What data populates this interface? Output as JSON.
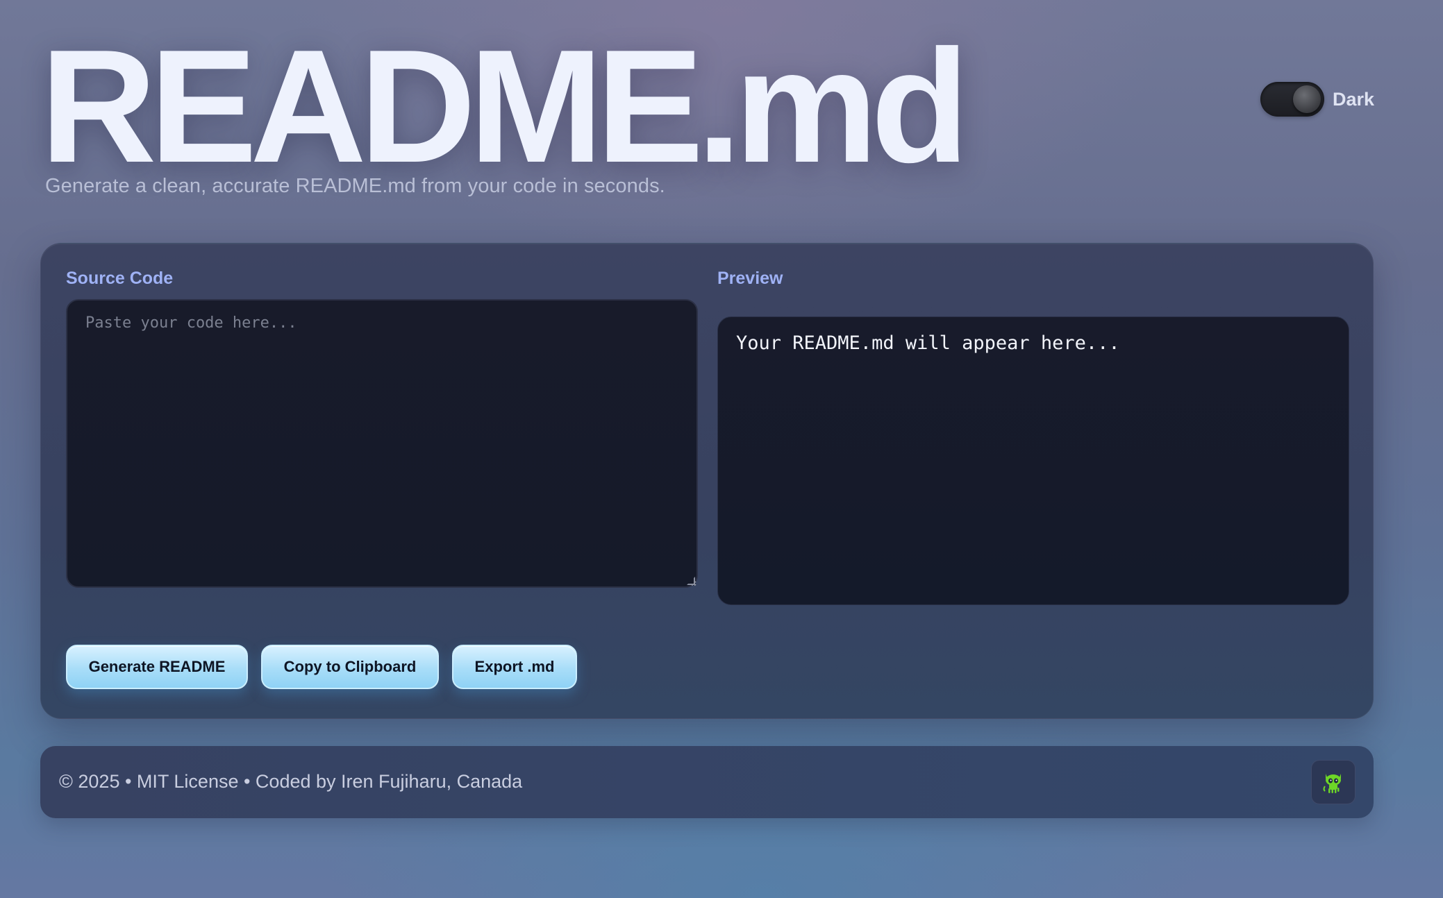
{
  "header": {
    "title": "README.md",
    "subtitle": "Generate a clean, accurate README.md from your code in seconds."
  },
  "theme_toggle": {
    "label": "Dark",
    "state": "on",
    "icon": "toggle-switch"
  },
  "source": {
    "label": "Source Code",
    "placeholder": "Paste your code here...",
    "value": ""
  },
  "preview": {
    "label": "Preview",
    "content": "Your README.md will appear here..."
  },
  "actions": {
    "generate_label": "Generate README",
    "copy_label": "Copy to Clipboard",
    "export_label": "Export .md"
  },
  "footer": {
    "text": "© 2025 • MIT License • Coded by Iren Fujiharu, Canada",
    "github_icon": "github-octocat-icon"
  },
  "colors": {
    "accent_label": "#9fb2f5",
    "button_blue": "#a8ddf8",
    "github_icon_green": "#6dd627"
  }
}
